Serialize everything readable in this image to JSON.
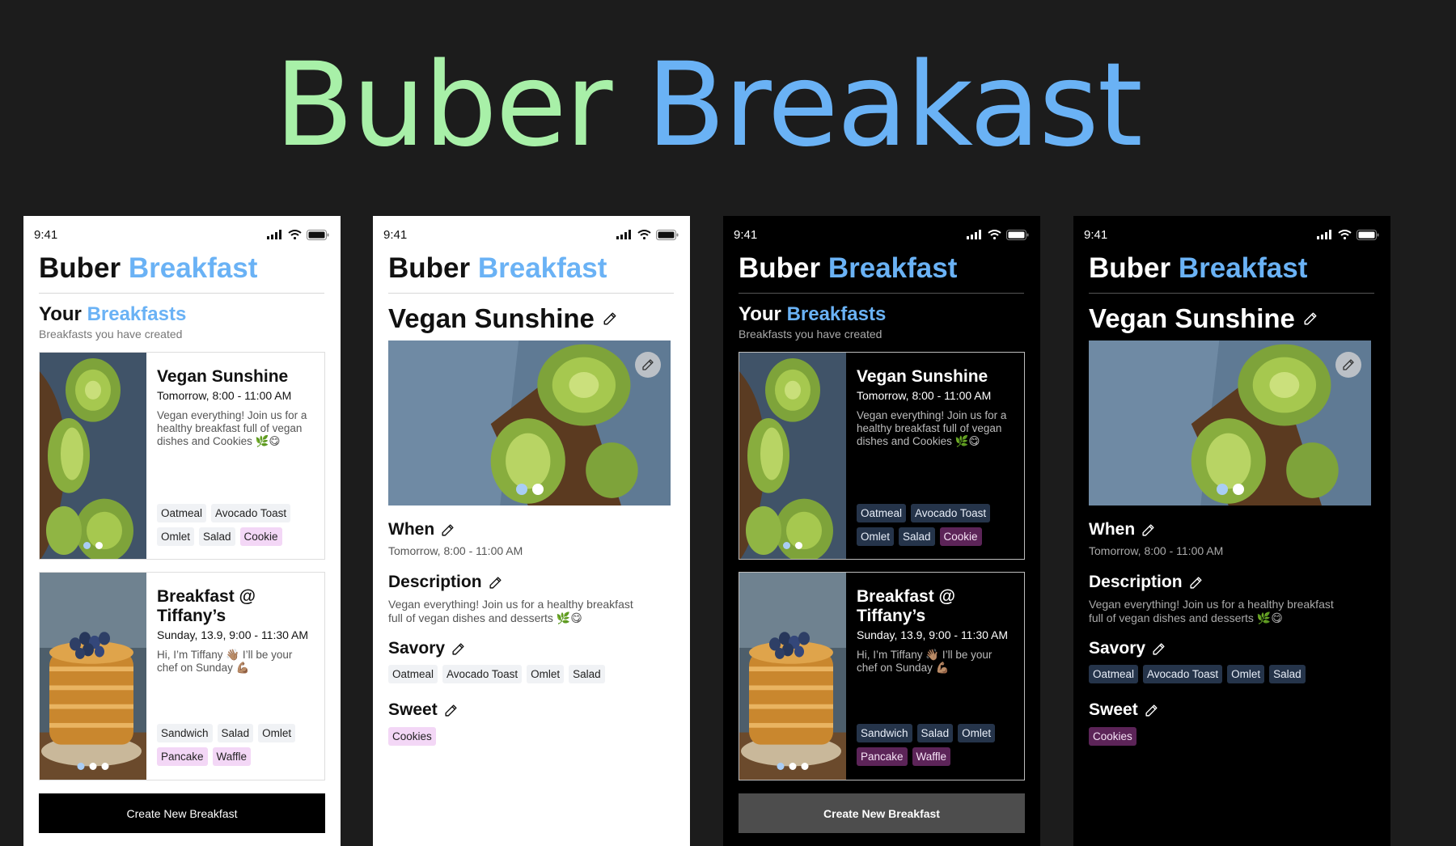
{
  "hero": {
    "word1": "Buber",
    "word2": "Breakast"
  },
  "colors": {
    "green": "#a8f0a8",
    "blue": "#6ab2f5",
    "bg": "#1c1c1c"
  },
  "status": {
    "time": "9:41"
  },
  "app": {
    "title1": "Buber",
    "title2": "Breakfast"
  },
  "list": {
    "title1": "Your",
    "title2": "Breakfasts",
    "subtitle": "Breakfasts you have created",
    "cards": [
      {
        "title": "Vegan Sunshine",
        "time": "Tomorrow, 8:00 - 11:00 AM",
        "desc": "Vegan everything! Join us for a healthy breakfast full of vegan dishes and Cookies 🌿😋",
        "tags": [
          "Oatmeal",
          "Avocado Toast",
          "Omlet",
          "Salad"
        ],
        "sweet_tags": [
          "Cookie"
        ]
      },
      {
        "title": "Breakfast @ Tiffany’s",
        "time": "Sunday, 13.9, 9:00 - 11:30 AM",
        "desc": "Hi, I’m Tiffany 👋🏽 I’ll be your chef on Sunday 💪🏽",
        "tags": [
          "Sandwich",
          "Salad",
          "Omlet"
        ],
        "sweet_tags": [
          "Pancake",
          "Waffle"
        ]
      }
    ],
    "button": "Create New Breakfast"
  },
  "detail": {
    "title": "Vegan Sunshine",
    "when_label": "When",
    "when_value": "Tomorrow, 8:00 - 11:00 AM",
    "desc_label": "Description",
    "desc_value": "Vegan everything! Join us for a healthy breakfast full of vegan dishes and desserts 🌿😋",
    "savory_label": "Savory",
    "savory": [
      "Oatmeal",
      "Avocado Toast",
      "Omlet",
      "Salad"
    ],
    "sweet_label": "Sweet",
    "sweet": [
      "Cookies"
    ]
  }
}
